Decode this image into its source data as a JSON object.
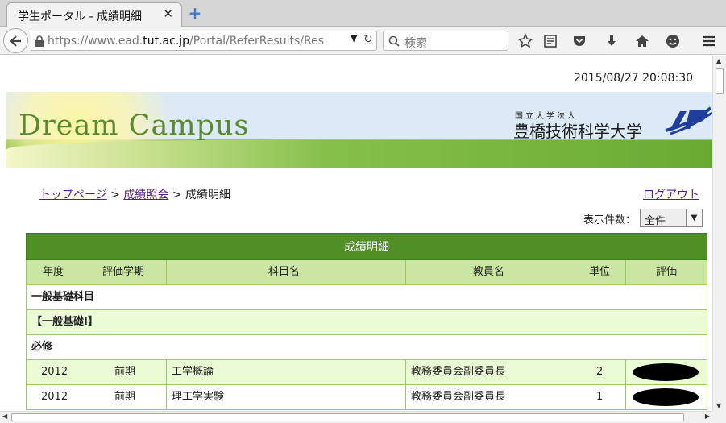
{
  "browser": {
    "tab_title": "学生ポータル - 成績明細",
    "tab_close": "✕",
    "url_prefix": "https://www.ead.",
    "url_host": "tut.ac.jp",
    "url_path": "/Portal/ReferResults/Res",
    "search_placeholder": "検索"
  },
  "page": {
    "datetime": "2015/08/27 20:08:30",
    "brand": "Dream Campus",
    "university_sub": "国立大学法人",
    "university_name": "豊橋技術科学大学",
    "breadcrumb": {
      "home": "トップページ",
      "sep1": " > ",
      "results": "成績照会",
      "sep2": " > ",
      "current": "成績明細"
    },
    "logout": "ログアウト",
    "display_count_label": "表示件数：",
    "display_count_value": "全件"
  },
  "table": {
    "title": "成績明細",
    "headers": {
      "year": "年度",
      "term": "評価学期",
      "subject": "科目名",
      "teacher": "教員名",
      "credits": "単位",
      "grade": "評価"
    },
    "section": "一般基礎科目",
    "subsection": "【一般基礎Ⅰ】",
    "category": "必修",
    "rows": [
      {
        "year": "2012",
        "term": "前期",
        "subject": "工学概論",
        "teacher": "教務委員会副委員長",
        "credits": "2"
      },
      {
        "year": "2012",
        "term": "前期",
        "subject": "理工学実験",
        "teacher": "教務委員会副委員長",
        "credits": "1"
      }
    ]
  }
}
